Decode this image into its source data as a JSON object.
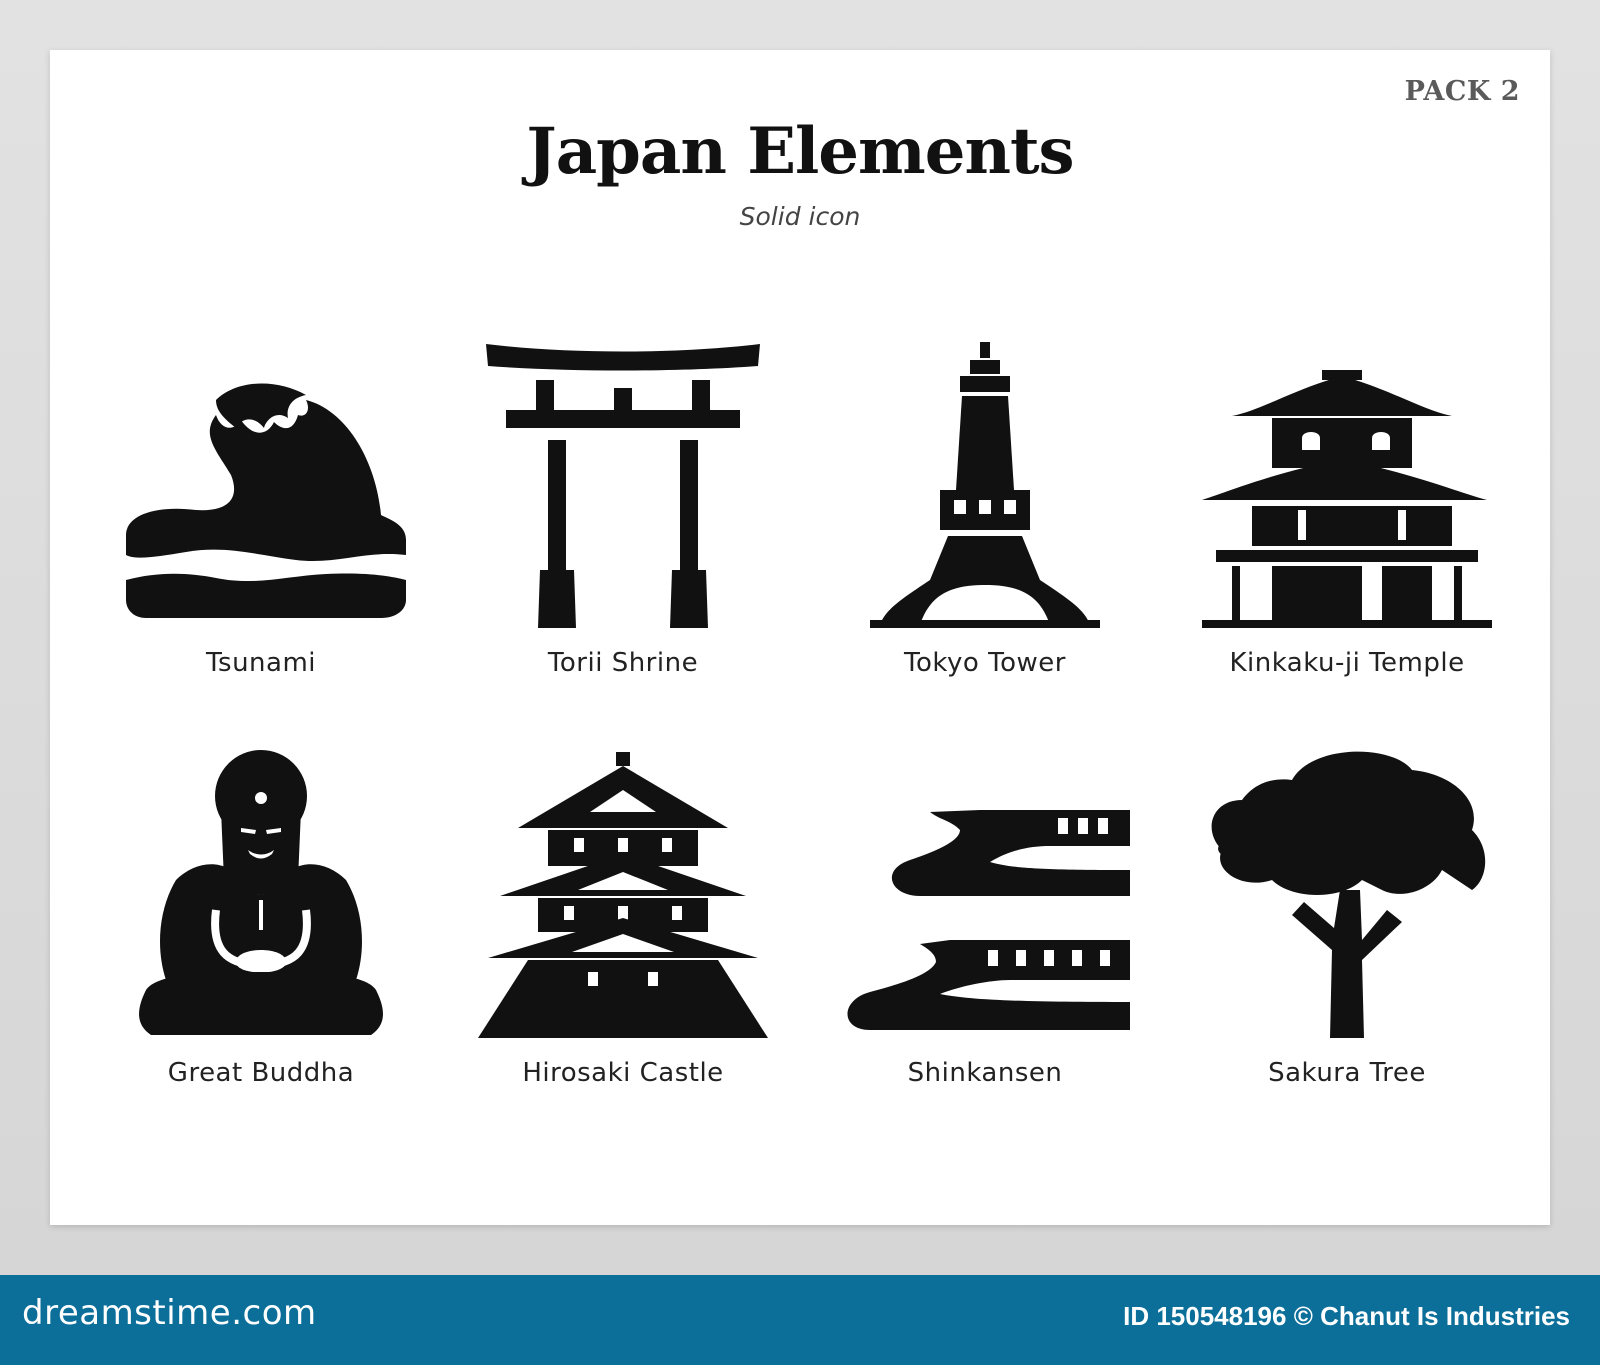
{
  "header": {
    "pack": "PACK 2",
    "title": "Japan Elements",
    "subtitle": "Solid icon"
  },
  "icons": [
    {
      "label": "Tsunami",
      "icon": "wave-icon"
    },
    {
      "label": "Torii Shrine",
      "icon": "torii-gate-icon"
    },
    {
      "label": "Tokyo Tower",
      "icon": "tower-icon"
    },
    {
      "label": "Kinkaku-ji Temple",
      "icon": "temple-icon"
    },
    {
      "label": "Great Buddha",
      "icon": "buddha-icon"
    },
    {
      "label": "Hirosaki Castle",
      "icon": "castle-icon"
    },
    {
      "label": "Shinkansen",
      "icon": "train-icon"
    },
    {
      "label": "Sakura Tree",
      "icon": "tree-icon"
    }
  ],
  "footer": {
    "logo": "dreamstime.com",
    "credit": "ID 150548196 © Chanut Is Industries"
  },
  "colors": {
    "icon": "#111111",
    "footer": "#0b6f9a"
  }
}
